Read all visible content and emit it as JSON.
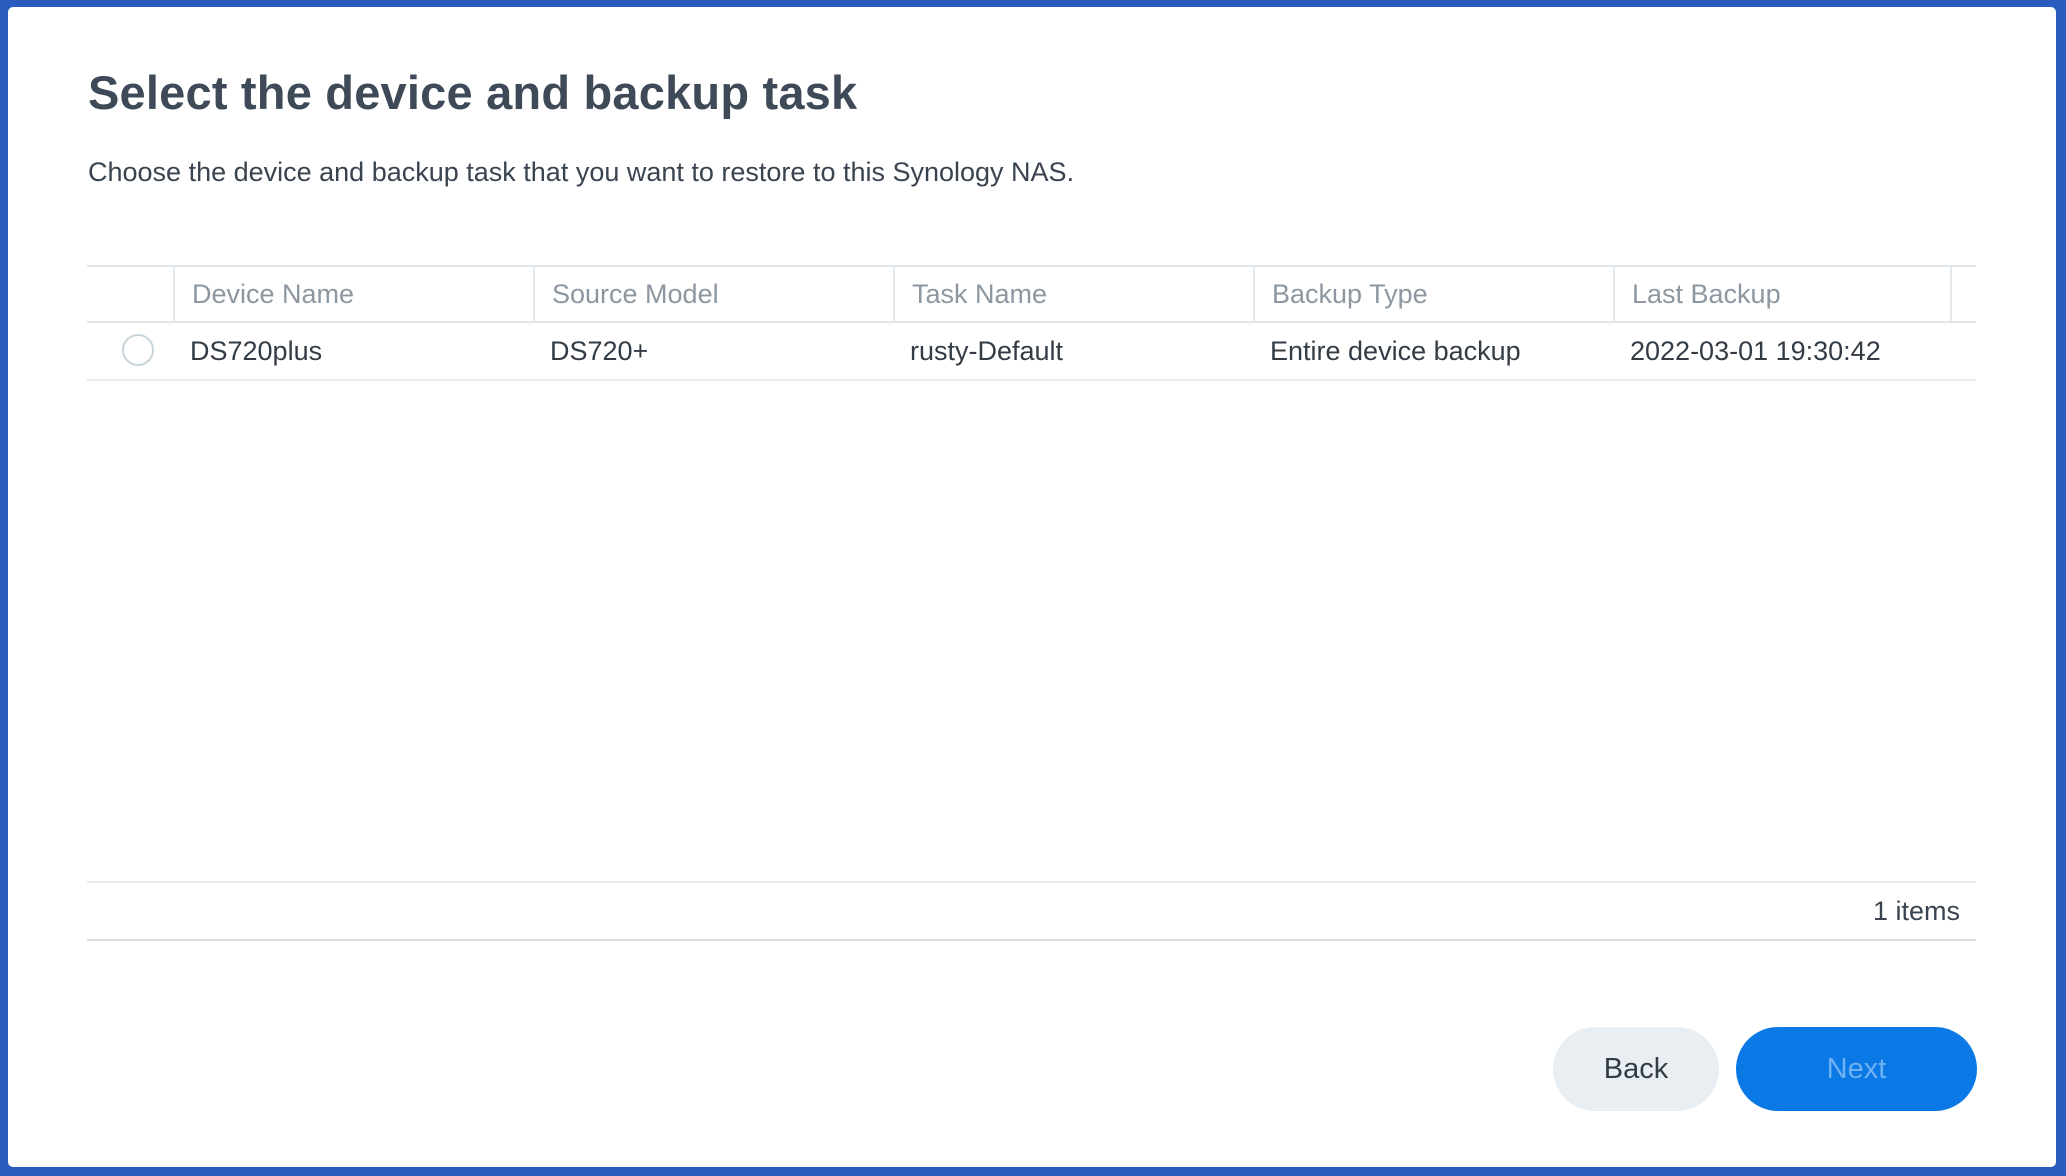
{
  "dialog": {
    "title": "Select the device and backup task",
    "subtitle": "Choose the device and backup task that you want to restore to this Synology NAS."
  },
  "table": {
    "columns": [
      "Device Name",
      "Source Model",
      "Task Name",
      "Backup Type",
      "Last Backup"
    ],
    "rows": [
      {
        "selected": false,
        "device_name": "DS720plus",
        "source_model": "DS720+",
        "task_name": "rusty-Default",
        "backup_type": "Entire device backup",
        "last_backup": "2022-03-01 19:30:42"
      }
    ],
    "item_count": "1 items"
  },
  "buttons": {
    "back": "Back",
    "next": "Next",
    "next_enabled": false
  },
  "colors": {
    "window_border": "#2a5cc0",
    "primary": "#0a79e6",
    "secondary_button": "#e9eef2",
    "title_text": "#3f4a58"
  },
  "icons": {
    "row_selector": "radio-button"
  }
}
